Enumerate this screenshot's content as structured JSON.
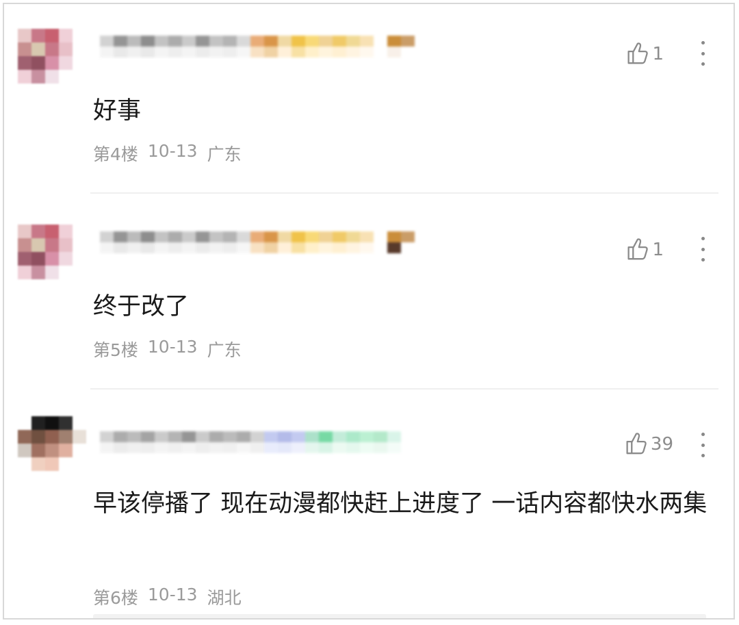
{
  "comments": [
    {
      "content": "好事",
      "floor": "第4楼",
      "date": "10-13",
      "location": "广东",
      "likes": "1",
      "like_icon": "thumbs-up-icon",
      "more_icon": "more-vertical-icon",
      "avatar_pixels": [
        "#e8c8c8",
        "#c87888",
        "#c86070",
        "#f0d0d8",
        "#ffffff",
        "#c89090",
        "#d8c8b0",
        "#c87888",
        "#e8c0c8",
        "#ffffff",
        "#a06070",
        "#905060",
        "#d890a8",
        "#f0d8e0",
        "#ffffff",
        "#f0d0d8",
        "#c890a0",
        "#f0e0e8",
        "#ffffff",
        "#ffffff"
      ],
      "name_pixels": [
        "#d0d0d0",
        "#909090",
        "#b8b8b8",
        "#888888",
        "#c0c0c0",
        "#a8a8a8",
        "#c8c8c8",
        "#909090",
        "#c0c0c0",
        "#b0b0b0",
        "#d8d8d8",
        "#e8a870",
        "#d89040",
        "#f0d8a0",
        "#f0c040",
        "#f8d870",
        "#f0d090",
        "#f0c860",
        "#f0d890",
        "#f8e0b0",
        "#ffffff",
        "#c88830",
        "#c89860",
        "#f4f4f4",
        "#e8e8e8",
        "#f0f0f0",
        "#e8e8e8",
        "#f4f4f4",
        "#eeeeee",
        "#f4f4f4",
        "#ececec",
        "#f2f2f2",
        "#eeeeee",
        "#f6f6f6",
        "#f8e0c0",
        "#f0d0a0",
        "#fff0d8",
        "#f8e0a0",
        "#fff0c8",
        "#fff4dc",
        "#fff0d0",
        "#fff4e0",
        "#fff8ee",
        "#ffffff",
        "#f8f0e8",
        "#ffffff"
      ]
    },
    {
      "content": "终于改了",
      "floor": "第5楼",
      "date": "10-13",
      "location": "广东",
      "likes": "1",
      "like_icon": "thumbs-up-icon",
      "more_icon": "more-vertical-icon",
      "avatar_pixels": [
        "#e8c8c8",
        "#c87888",
        "#c86070",
        "#f0d0d8",
        "#ffffff",
        "#c89090",
        "#d8c8b0",
        "#c87888",
        "#e8c0c8",
        "#ffffff",
        "#a06070",
        "#905060",
        "#d890a8",
        "#f0d8e0",
        "#ffffff",
        "#f0d0d8",
        "#c890a0",
        "#f0e0e8",
        "#ffffff",
        "#ffffff"
      ],
      "name_pixels": [
        "#d0d0d0",
        "#909090",
        "#b8b8b8",
        "#888888",
        "#c0c0c0",
        "#a8a8a8",
        "#c8c8c8",
        "#909090",
        "#c0c0c0",
        "#b0b0b0",
        "#d8d8d8",
        "#e8a870",
        "#d89040",
        "#f0d8a0",
        "#f0c040",
        "#f8d870",
        "#f0d090",
        "#f0c860",
        "#f0d890",
        "#f8e0b0",
        "#ffffff",
        "#c88830",
        "#c89860",
        "#f4f4f4",
        "#e8e8e8",
        "#f0f0f0",
        "#e8e8e8",
        "#f4f4f4",
        "#eeeeee",
        "#f4f4f4",
        "#ececec",
        "#f2f2f2",
        "#eeeeee",
        "#f6f6f6",
        "#f8e0c0",
        "#f0d0a0",
        "#fff0d8",
        "#f8e0a0",
        "#fff0c8",
        "#fff4dc",
        "#fff0d0",
        "#fff4e0",
        "#fff8ee",
        "#ffffff",
        "#503020",
        "#ffffff"
      ]
    },
    {
      "content": "早该停播了 现在动漫都快赶上进度了 一话内容都快水两集",
      "floor": "第6楼",
      "date": "10-13",
      "location": "湖北",
      "likes": "39",
      "like_icon": "thumbs-up-icon",
      "more_icon": "more-vertical-icon",
      "avatar_pixels": [
        "#ffffff",
        "#202020",
        "#101010",
        "#303030",
        "#ffffff",
        "#906858",
        "#705040",
        "#906050",
        "#a08070",
        "#e8e0d8",
        "#d0c8c0",
        "#a07060",
        "#c09080",
        "#e0b0a0",
        "#ffffff",
        "#ffffff",
        "#f0d0c0",
        "#f0c8b8",
        "#ffffff",
        "#ffffff"
      ],
      "name_pixels": [
        "#d0d0d0",
        "#a8a8a8",
        "#b8b8b8",
        "#a0a0a0",
        "#c8c8c8",
        "#b0b0b0",
        "#909090",
        "#c8c8c8",
        "#a8a8a8",
        "#b8b8b8",
        "#a8a8a8",
        "#d0d0d0",
        "#c0c8f0",
        "#b0b8e8",
        "#c0c8f0",
        "#a8e0c8",
        "#70d8a0",
        "#c0ecd8",
        "#a8e8c8",
        "#b8f0d0",
        "#b0e8c8",
        "#d8f4e8",
        "#ffffff",
        "#f4f4f4",
        "#ececec",
        "#f0f0f0",
        "#eeeeee",
        "#f4f4f4",
        "#f0f0f0",
        "#f4f4f4",
        "#eeeeee",
        "#f2f2f2",
        "#f0f0f0",
        "#f6f6f6",
        "#f0f0f0",
        "#e8ecfc",
        "#e4e8fa",
        "#eef0fc",
        "#e4f6ee",
        "#d8f4e6",
        "#ecfaf2",
        "#e4f8ee",
        "#eefcf4",
        "#eaf8f0",
        "#f4fcf8",
        "#ffffff"
      ]
    }
  ]
}
